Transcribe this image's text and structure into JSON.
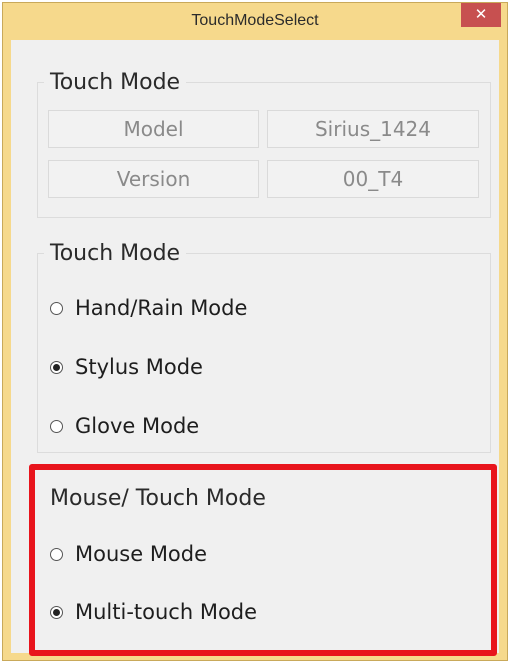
{
  "window": {
    "title": "TouchModeSelect",
    "close_glyph": "✕"
  },
  "device_info": {
    "group_title": "Touch Mode",
    "rows": [
      {
        "label": "Model",
        "value": "Sirius_1424"
      },
      {
        "label": "Version",
        "value": "00_T4"
      }
    ]
  },
  "touch_mode": {
    "group_title": "Touch Mode",
    "options": [
      {
        "label": "Hand/Rain Mode",
        "checked": false
      },
      {
        "label": "Stylus Mode",
        "checked": true
      },
      {
        "label": "Glove Mode",
        "checked": false
      }
    ]
  },
  "mouse_touch_mode": {
    "group_title": "Mouse/ Touch Mode",
    "options": [
      {
        "label": "Mouse Mode",
        "checked": false
      },
      {
        "label": "Multi-touch Mode",
        "checked": true
      }
    ]
  },
  "colors": {
    "window_frame": "#f6d98c",
    "close_button": "#c75050",
    "highlight": "#e8141c",
    "client_bg": "#f0f0f0"
  },
  "icons": {
    "close": "close-icon",
    "radio": "radio-button"
  }
}
